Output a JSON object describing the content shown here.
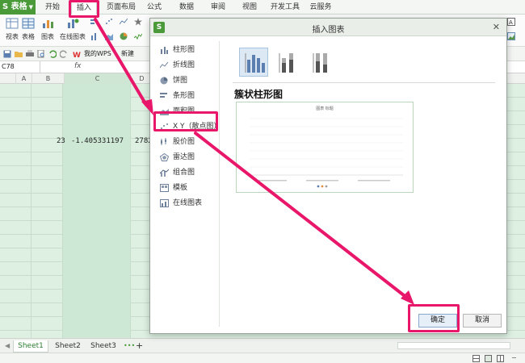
{
  "app": {
    "name": "S 表格"
  },
  "menu": {
    "tabs": [
      "开始",
      "插入",
      "页面布局",
      "公式",
      "数据",
      "审阅",
      "视图",
      "开发工具",
      "云服务"
    ],
    "active": "插入"
  },
  "ribbon": {
    "labels": [
      "视表",
      "表格",
      "图表",
      "在线图表"
    ],
    "my_wps": "我的WPS",
    "new_label": "新建"
  },
  "formula_bar": {
    "cell_ref": "C78",
    "fx": "fx"
  },
  "columns": [
    "A",
    "B",
    "C",
    "D"
  ],
  "cells": {
    "b": "23",
    "c": "-1.405331197",
    "d": "2782"
  },
  "sheets": [
    "Sheet1",
    "Sheet2",
    "Sheet3"
  ],
  "active_sheet": "Sheet1",
  "add_sheet": "+",
  "dialog": {
    "title": "插入图表",
    "close": "✕",
    "chart_types": [
      {
        "label": "柱形图",
        "icon": "column-chart-icon"
      },
      {
        "label": "折线图",
        "icon": "line-chart-icon"
      },
      {
        "label": "饼图",
        "icon": "pie-chart-icon"
      },
      {
        "label": "条形图",
        "icon": "bar-chart-icon"
      },
      {
        "label": "面积图",
        "icon": "area-chart-icon"
      },
      {
        "label": "X Y（散点图）",
        "icon": "scatter-chart-icon"
      },
      {
        "label": "股价图",
        "icon": "stock-chart-icon"
      },
      {
        "label": "雷达图",
        "icon": "radar-chart-icon"
      },
      {
        "label": "组合图",
        "icon": "combo-chart-icon"
      },
      {
        "label": "模板",
        "icon": "template-icon"
      },
      {
        "label": "在线图表",
        "icon": "online-chart-icon"
      }
    ],
    "selected_type": "X Y（散点图）",
    "chart_type_title": "簇状柱形图",
    "preview": {
      "title": "图表 标题"
    },
    "ok": "确定",
    "cancel": "取消"
  },
  "colors": {
    "brand_green": "#4a9a3a",
    "annotation_pink": "#e8176a",
    "grid_green": "#ddf0e2",
    "chart_blue": "#5b7fb0"
  }
}
